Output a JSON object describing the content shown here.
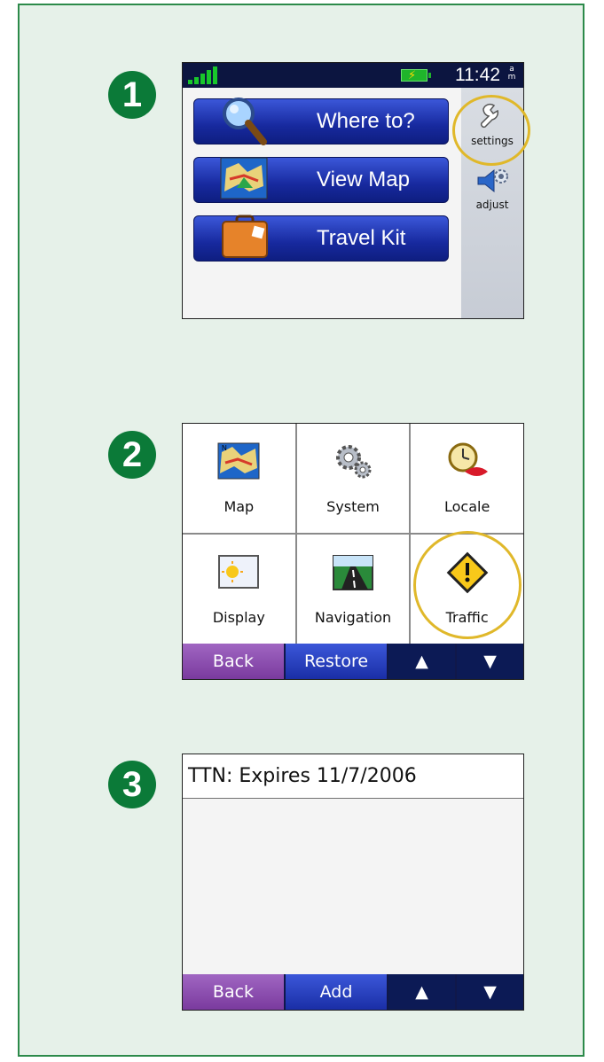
{
  "steps": [
    "1",
    "2",
    "3"
  ],
  "screen1": {
    "clock": "11:42",
    "ampm_top": "a",
    "ampm_bottom": "m",
    "buttons": [
      {
        "label": "Where to?",
        "icon": "magnifier-icon"
      },
      {
        "label": "View Map",
        "icon": "map-icon"
      },
      {
        "label": "Travel Kit",
        "icon": "suitcase-icon"
      }
    ],
    "side": [
      {
        "label": "settings",
        "icon": "wrench-icon"
      },
      {
        "label": "adjust",
        "icon": "speaker-icon"
      }
    ]
  },
  "screen2": {
    "tiles": [
      {
        "label": "Map",
        "icon": "map-icon"
      },
      {
        "label": "System",
        "icon": "gears-icon"
      },
      {
        "label": "Locale",
        "icon": "clock-lips-icon"
      },
      {
        "label": "Display",
        "icon": "sun-moon-icon"
      },
      {
        "label": "Navigation",
        "icon": "road-icon"
      },
      {
        "label": "Traffic",
        "icon": "warning-icon"
      }
    ],
    "back": "Back",
    "restore": "Restore",
    "up": "▲",
    "down": "▼"
  },
  "screen3": {
    "title": "TTN: Expires 11/7/2006",
    "back": "Back",
    "add": "Add",
    "up": "▲",
    "down": "▼"
  },
  "colors": {
    "highlight": "#e0b82a",
    "step": "#0b7a38",
    "panel_bg": "#e6f1e9"
  }
}
